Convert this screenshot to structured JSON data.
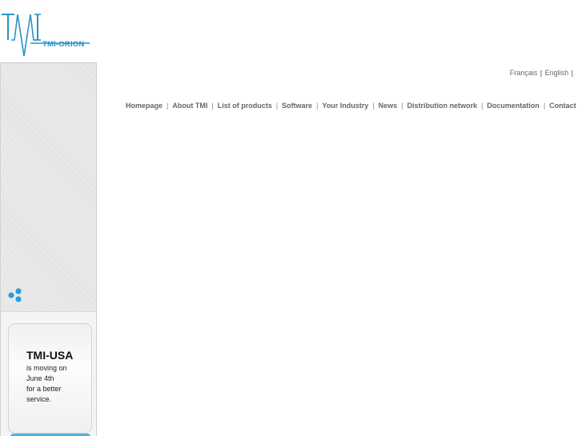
{
  "logo": {
    "mark": "TMI",
    "text": "TMI-ORION",
    "color": "#2a92c8"
  },
  "language": {
    "items": [
      {
        "label": "Français"
      },
      {
        "label": "English"
      }
    ],
    "separator": "|"
  },
  "nav": {
    "separator": "|",
    "items": [
      {
        "label": "Homepage"
      },
      {
        "label": "About TMI"
      },
      {
        "label": "List of products"
      },
      {
        "label": "Software"
      },
      {
        "label": "Your Industry"
      },
      {
        "label": "News"
      },
      {
        "label": "Distribution network"
      },
      {
        "label": "Documentation"
      },
      {
        "label": "Contact"
      }
    ]
  },
  "sidebar": {
    "dots_icon": "three-blue-dots-icon",
    "news": {
      "title": "TMI-USA",
      "lines": [
        "is moving on",
        "June 4th",
        "for a better",
        "service."
      ]
    },
    "accent": "#4fb3dd"
  }
}
